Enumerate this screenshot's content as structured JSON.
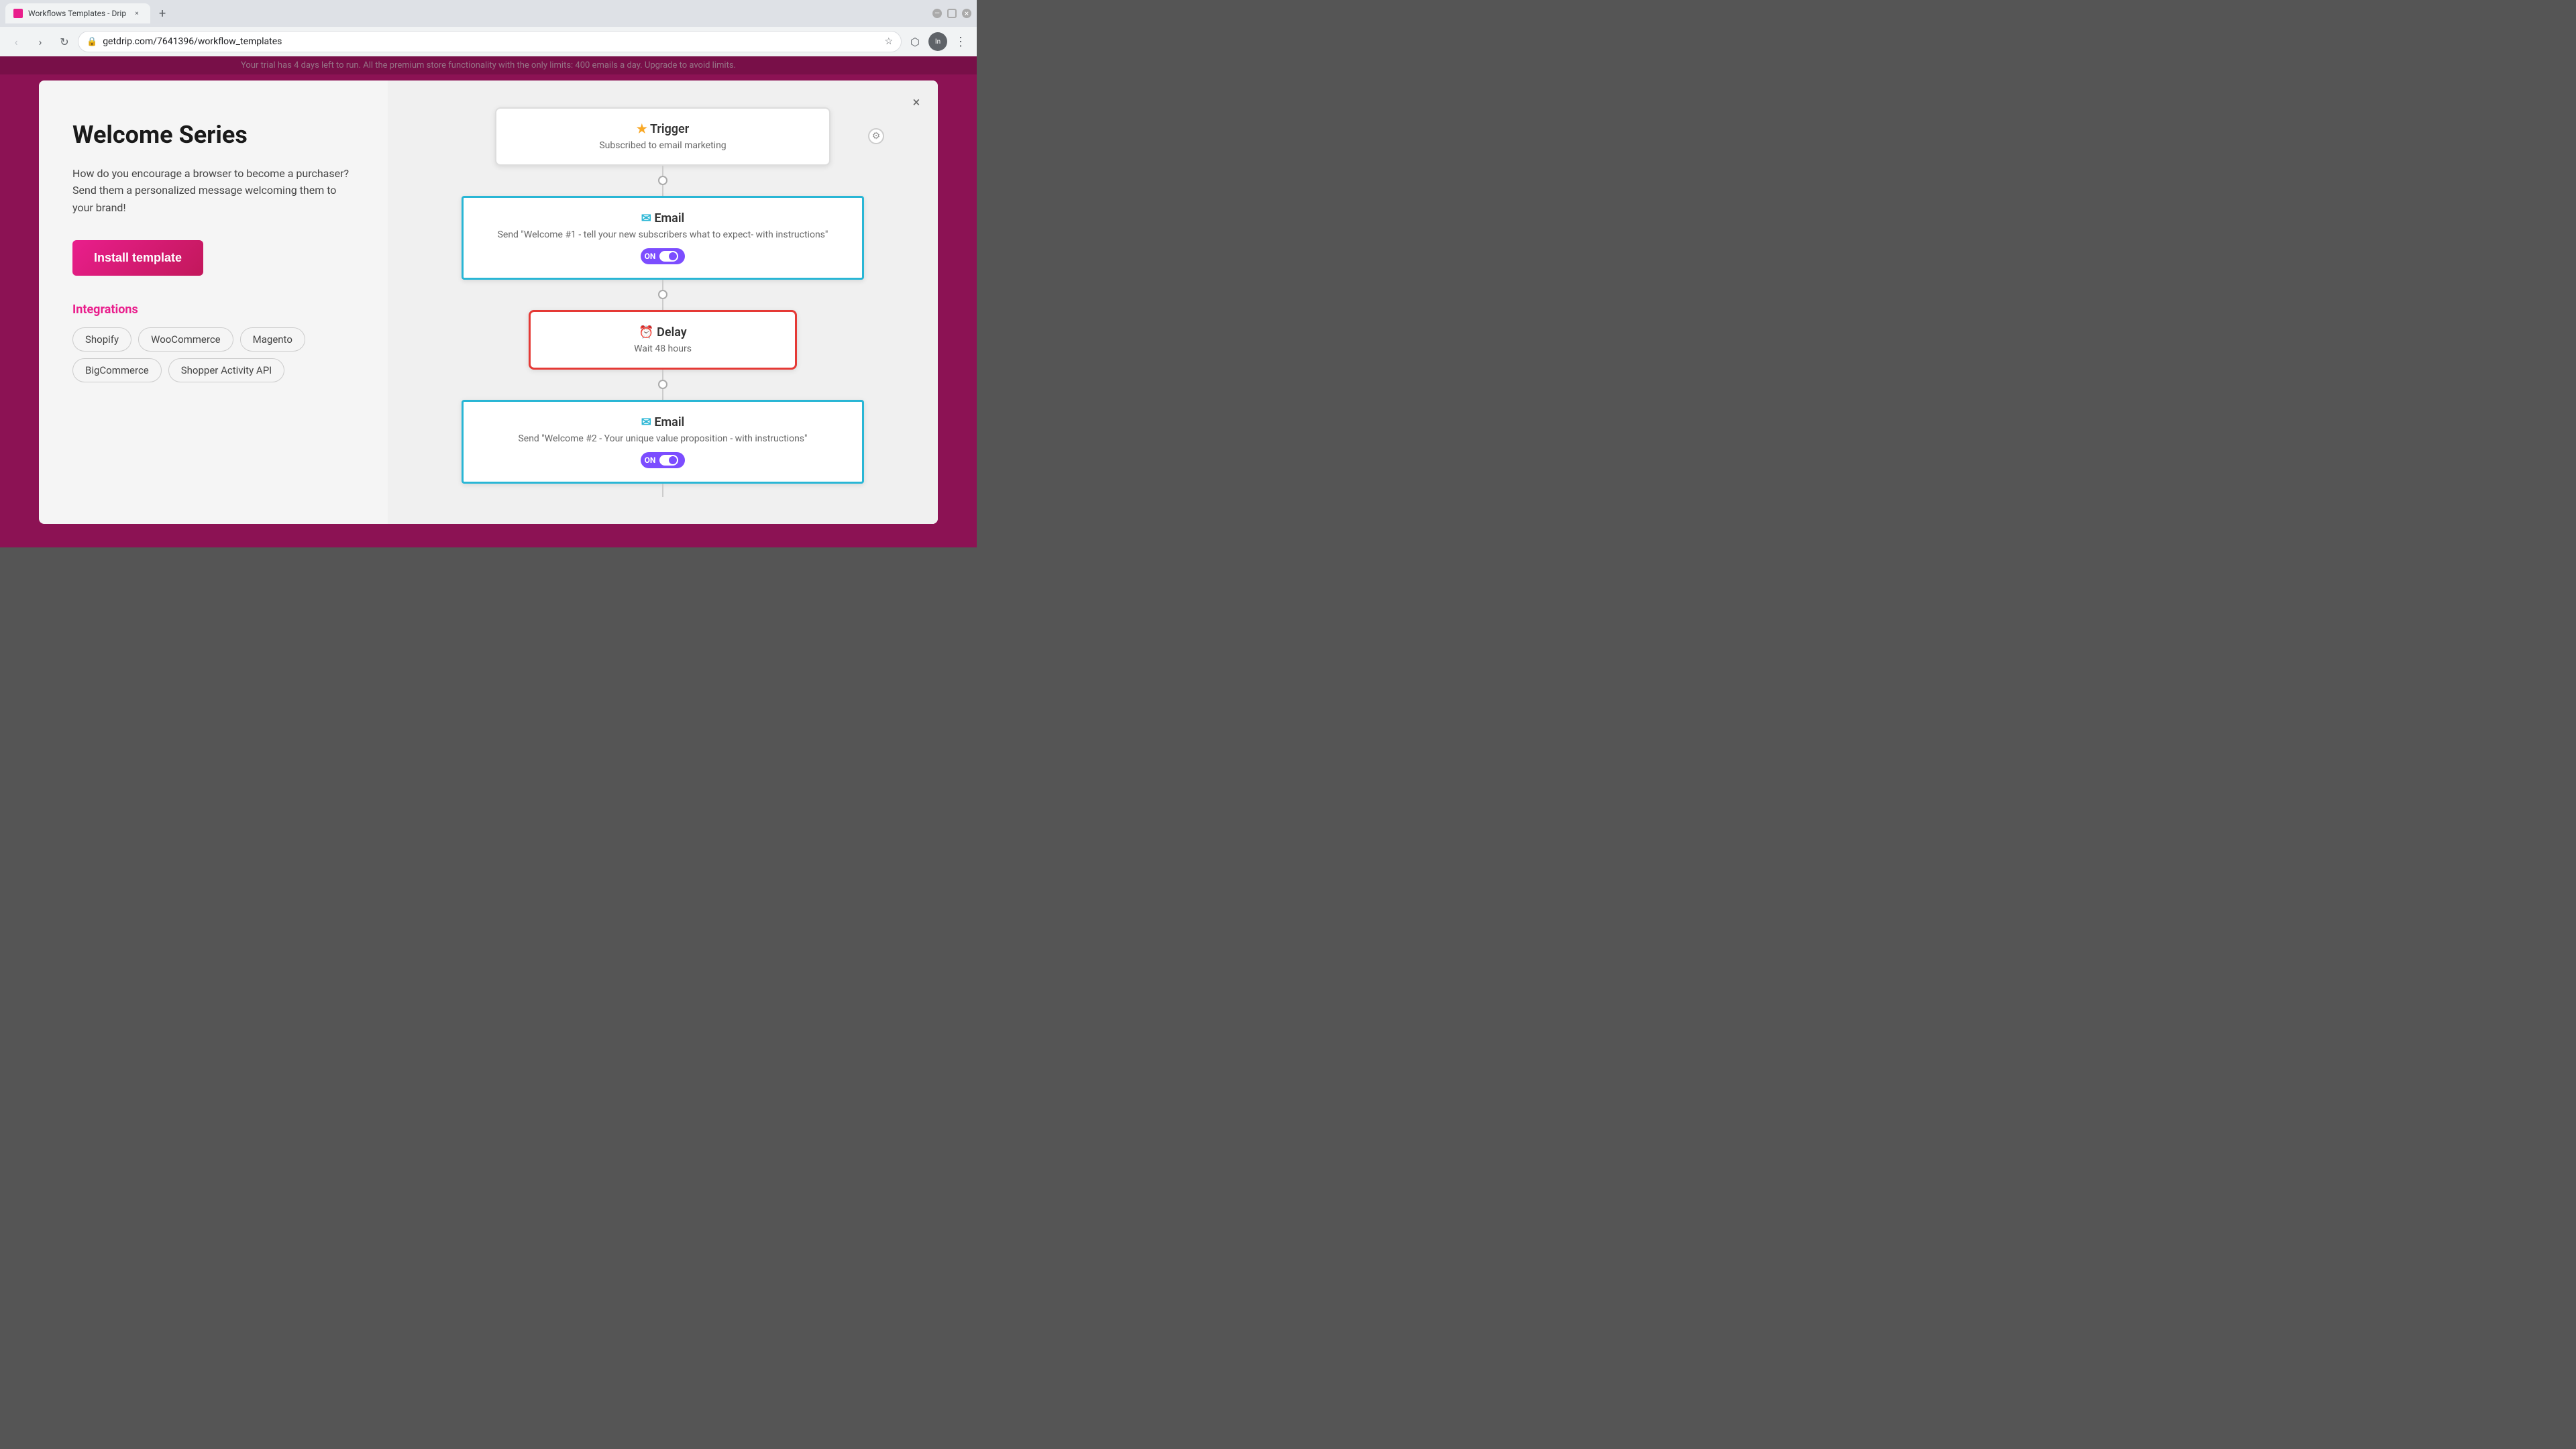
{
  "browser": {
    "tab_title": "Workflows Templates - Drip",
    "url": "getdrip.com/7641396/workflow_templates",
    "new_tab_label": "+",
    "back_label": "‹",
    "forward_label": "›",
    "refresh_label": "↻",
    "incognito_label": "Incognito",
    "menu_label": "⋮"
  },
  "top_banner": "Your trial has 4 days left to run. All the premium store functionality with the only limits: 400 emails a day. Upgrade to avoid limits.",
  "modal": {
    "close_label": "×",
    "title": "Welcome Series",
    "description": "How do you encourage a browser to become a purchaser? Send them a personalized message welcoming them to your brand!",
    "install_button_label": "Install template",
    "integrations_title": "Integrations",
    "integrations": [
      "Shopify",
      "WooCommerce",
      "Magento",
      "BigCommerce",
      "Shopper Activity API"
    ]
  },
  "workflow": {
    "trigger_title": "Trigger",
    "trigger_subtitle": "Subscribed to email marketing",
    "email1_title": "Email",
    "email1_subtitle": "Send \"Welcome #1 - tell your new subscribers what to expect- with instructions\"",
    "email1_toggle": "ON",
    "delay_title": "Delay",
    "delay_subtitle": "Wait 48 hours",
    "email2_title": "Email",
    "email2_subtitle": "Send \"Welcome #2 - Your unique value proposition - with instructions\"",
    "email2_toggle": "ON"
  },
  "icons": {
    "trigger_star": "★",
    "email_icon": "✉",
    "delay_icon": "⏰",
    "lock_icon": "🔒",
    "star_favorite": "☆",
    "settings_icon": "⚙"
  },
  "colors": {
    "brand_pink": "#e91e8c",
    "email_border": "#29b6d5",
    "delay_border": "#e53935",
    "toggle_bg": "#7c4dff"
  }
}
